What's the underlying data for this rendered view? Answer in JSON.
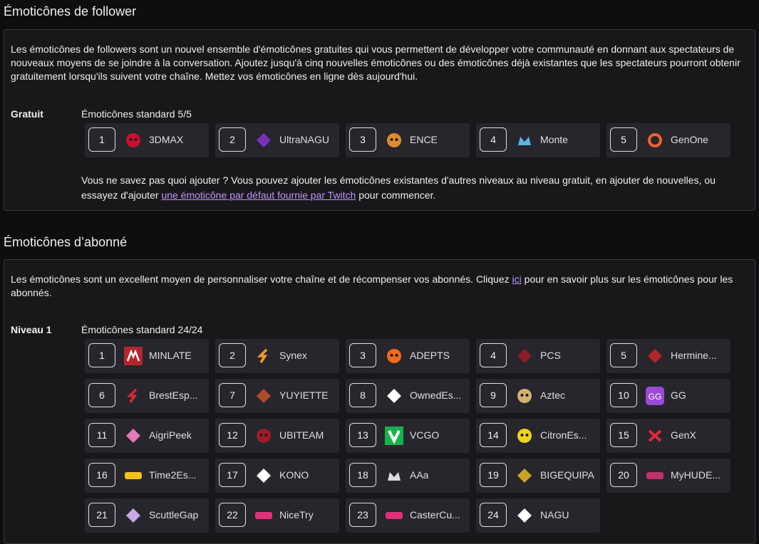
{
  "follower": {
    "title": "Émoticônes de follower",
    "description": "Les émoticônes de followers sont un nouvel ensemble d'émoticônes gratuites qui vous permettent de développer votre communauté en donnant aux spectateurs de nouveaux moyens de se joindre à la conversation. Ajoutez jusqu'à cinq nouvelles émoticônes ou des émoticônes déjà existantes que les spectateurs pourront obtenir gratuitement lorsqu'ils suivent votre chaîne. Mettez vos émoticônes en ligne dès aujourd'hui.",
    "tier_label": "Gratuit",
    "tier_sub": "Émoticônes standard 5/5",
    "slots": [
      {
        "num": "1",
        "name": "3DMAX",
        "icon": "red-mask-icon",
        "color": "#c8102e"
      },
      {
        "num": "2",
        "name": "UltraNAGU",
        "icon": "purple-ninja-icon",
        "color": "#7b2fbf"
      },
      {
        "num": "3",
        "name": "ENCE",
        "icon": "orange-face-icon",
        "color": "#e08a2e"
      },
      {
        "num": "4",
        "name": "Monte",
        "icon": "blue-crown-icon",
        "color": "#5ab4e8"
      },
      {
        "num": "5",
        "name": "GenOne",
        "icon": "orange-ring-icon",
        "color": "#f0602a"
      }
    ],
    "help_text_1": "Vous ne savez pas quoi ajouter ? Vous pouvez ajouter les émoticônes existantes d'autres niveaux au niveau gratuit, en ajouter de nouvelles, ou essayez d'ajouter ",
    "help_link": "une émoticône par défaut fournie par Twitch",
    "help_text_2": " pour commencer."
  },
  "subscriber": {
    "title": "Émoticônes d’abonné",
    "desc_1": "Les émoticônes sont un excellent moyen de personnaliser votre chaîne et de récompenser vos abonnés. Cliquez ",
    "desc_link": "ici",
    "desc_2": " pour en savoir plus sur les émoticônes pour les abonnés.",
    "tier_label": "Niveau 1",
    "tier_sub": "Émoticônes standard 24/24",
    "slots": [
      {
        "num": "1",
        "name": "MINLATE",
        "icon": "red-m-logo-icon",
        "color": "#b3262e"
      },
      {
        "num": "2",
        "name": "Synex",
        "icon": "orange-s-icon",
        "color": "#f29d1f"
      },
      {
        "num": "3",
        "name": "ADEPTS",
        "icon": "orange-mask-icon",
        "color": "#f26a1b"
      },
      {
        "num": "4",
        "name": "PCS",
        "icon": "red-crosshair-icon",
        "color": "#8a1e2b"
      },
      {
        "num": "5",
        "name": "Hermine...",
        "icon": "red-ermine-icon",
        "color": "#b3262e"
      },
      {
        "num": "6",
        "name": "BrestEsp...",
        "icon": "red-b-icon",
        "color": "#d62839"
      },
      {
        "num": "7",
        "name": "YUYIETTE",
        "icon": "brown-horse-icon",
        "color": "#b04a2a"
      },
      {
        "num": "8",
        "name": "OwnedEs...",
        "icon": "white-swoosh-icon",
        "color": "#ffffff"
      },
      {
        "num": "9",
        "name": "Aztec",
        "icon": "gold-head-icon",
        "color": "#d4b070"
      },
      {
        "num": "10",
        "name": "GG",
        "icon": "purple-gg-icon",
        "color": "#9a4ad6"
      },
      {
        "num": "11",
        "name": "AigriPeek",
        "icon": "pink-bird-icon",
        "color": "#e07ab8"
      },
      {
        "num": "12",
        "name": "UBITEAM",
        "icon": "red-globe-icon",
        "color": "#a01c2a"
      },
      {
        "num": "13",
        "name": "VCGO",
        "icon": "green-v-icon",
        "color": "#17b34a"
      },
      {
        "num": "14",
        "name": "CitronEs...",
        "icon": "yellow-lemon-icon",
        "color": "#f2d21b"
      },
      {
        "num": "15",
        "name": "GenX",
        "icon": "red-x-icon",
        "color": "#e02a3a"
      },
      {
        "num": "16",
        "name": "Time2Es...",
        "icon": "yellow-t2k-icon",
        "color": "#f2c21b"
      },
      {
        "num": "17",
        "name": "KONO",
        "icon": "white-bird-icon",
        "color": "#ffffff"
      },
      {
        "num": "18",
        "name": "AAa",
        "icon": "white-mountain-icon",
        "color": "#dcdcdc"
      },
      {
        "num": "19",
        "name": "BIGEQUIPA",
        "icon": "gold-badge-icon",
        "color": "#c9a227"
      },
      {
        "num": "20",
        "name": "MyHUDE...",
        "icon": "pink-banner-icon",
        "color": "#c2306a"
      },
      {
        "num": "21",
        "name": "ScuttleGap",
        "icon": "lavender-crab-icon",
        "color": "#c8a8e8"
      },
      {
        "num": "22",
        "name": "NiceTry",
        "icon": "pink-text-icon",
        "color": "#e0307a"
      },
      {
        "num": "23",
        "name": "CasterCu...",
        "icon": "pink-caster-icon",
        "color": "#e0307a"
      },
      {
        "num": "24",
        "name": "NAGU",
        "icon": "white-ninja-icon",
        "color": "#ffffff"
      }
    ]
  }
}
